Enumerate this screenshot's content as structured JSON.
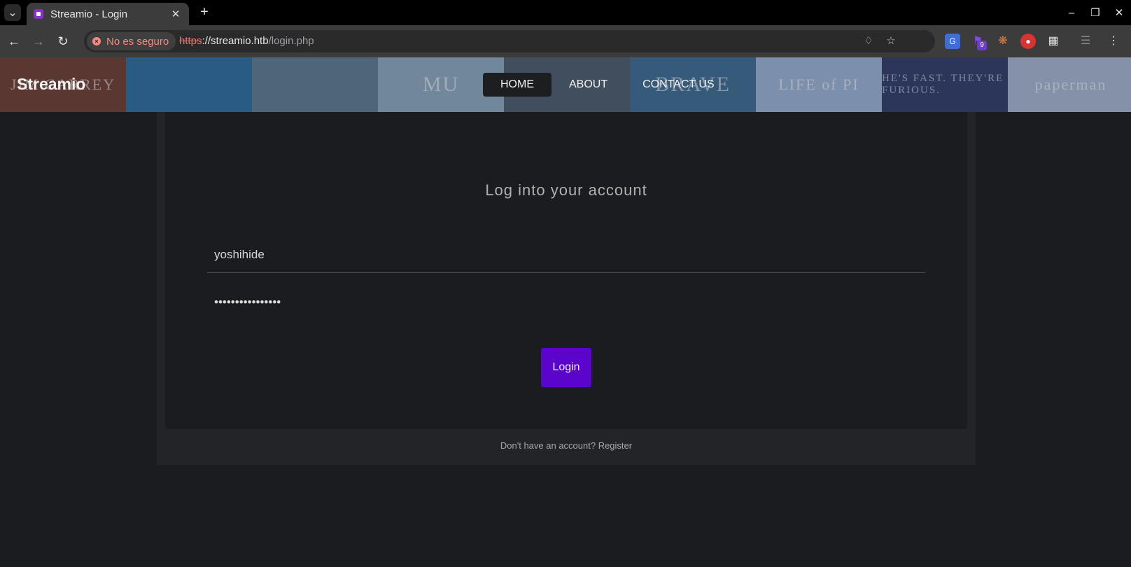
{
  "browser": {
    "tab_title": "Streamio - Login",
    "tab_close": "✕",
    "new_tab": "+",
    "security_label": "No es seguro",
    "url_scheme": "https",
    "url_host": "://streamio.htb",
    "url_path": "/login.php",
    "extension_badge": "9"
  },
  "header": {
    "brand": "Streamio",
    "posters": [
      {
        "text": "JIM CARREY",
        "bg": "#6b3b2c"
      },
      {
        "text": "",
        "bg": "#2b6b9e"
      },
      {
        "text": "",
        "bg": "#5b7a8e"
      },
      {
        "text": "MU",
        "bg": "#8aa7bd"
      },
      {
        "text": "",
        "bg": "#4a5a6a"
      },
      {
        "text": "BRAVE",
        "bg": "#3a6a8f"
      },
      {
        "text": "LIFE of PI",
        "bg": "#98b2d3"
      },
      {
        "text": "HE'S FAST. THEY'RE FURIOUS.",
        "bg": "#2e3a66"
      },
      {
        "text": "paperman",
        "bg": "#a5b3cc"
      }
    ],
    "nav": [
      {
        "label": "HOME",
        "active": true
      },
      {
        "label": "ABOUT",
        "active": false
      },
      {
        "label": "CONTACT US",
        "active": false
      }
    ]
  },
  "login": {
    "title": "Log into your account",
    "username_value": "yoshihide",
    "password_mask": "••••••••••••••••",
    "button_label": "Login",
    "register_text": "Don't have an account? Register"
  },
  "colors": {
    "accent": "#5a04cc",
    "page_bg": "#1b1c1f",
    "security_warning": "#f28b82"
  }
}
